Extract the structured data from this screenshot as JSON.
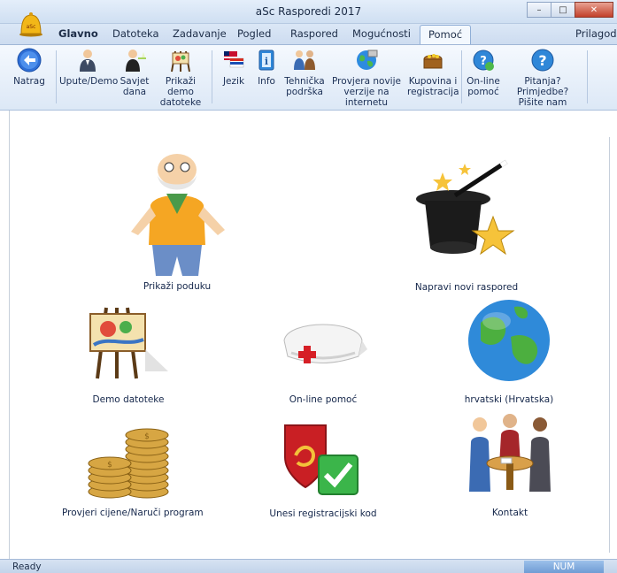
{
  "window": {
    "title": "aSc Rasporedi 2017",
    "logo_text": "aSc"
  },
  "menu": {
    "tabs": [
      {
        "label": "Glavno"
      },
      {
        "label": "Datoteka"
      },
      {
        "label": "Zadavanje"
      },
      {
        "label": "Pogled"
      },
      {
        "label": "Raspored"
      },
      {
        "label": "Mogućnosti"
      },
      {
        "label": "Pomoć"
      }
    ],
    "active_tab": "Pomoć",
    "customize_label": "Prilagodi"
  },
  "ribbon": {
    "back": {
      "label": "Natrag",
      "icon": "back-arrow-icon"
    },
    "guide": {
      "label": "Upute/Demo",
      "icon": "person-icon"
    },
    "tip": {
      "label_1": "Savjet",
      "label_2": "dana",
      "icon": "waiter-icon"
    },
    "demo_files": {
      "label_1": "Prikaži demo",
      "label_2": "datoteke",
      "icon": "easel-icon"
    },
    "language": {
      "label": "Jezik",
      "icon": "flags-icon"
    },
    "info": {
      "label": "Info",
      "icon": "info-book-icon"
    },
    "support": {
      "label_1": "Tehnička",
      "label_2": "podrška",
      "icon": "people-icon"
    },
    "update": {
      "label_1": "Provjera novije",
      "label_2": "verzije na internetu",
      "icon": "globe-update-icon"
    },
    "buy": {
      "label_1": "Kupovina i",
      "label_2": "registracija",
      "icon": "treasure-icon"
    },
    "online_help": {
      "label_1": "On-line",
      "label_2": "pomoć",
      "icon": "help-globe-icon"
    },
    "questions": {
      "label_1": "Pitanja? Primjedbe?",
      "label_2": "Pišite nam",
      "icon": "question-icon"
    }
  },
  "main": {
    "items": [
      {
        "label": "Prikaži poduku",
        "icon": "old-man-icon"
      },
      {
        "label": "Napravi novi raspored",
        "icon": "magic-hat-icon"
      },
      {
        "label": "Demo datoteke",
        "icon": "easel-painting-icon"
      },
      {
        "label": "On-line pomoć",
        "icon": "nurse-cap-icon"
      },
      {
        "label": "hrvatski (Hrvatska)",
        "icon": "globe-icon"
      },
      {
        "label": "Provjeri cijene/Naruči program",
        "icon": "coins-icon"
      },
      {
        "label": "Unesi registracijski kod",
        "icon": "shield-check-icon"
      },
      {
        "label": "Kontakt",
        "icon": "meeting-people-icon"
      }
    ]
  },
  "status": {
    "text": "Ready",
    "num": "NUM"
  }
}
